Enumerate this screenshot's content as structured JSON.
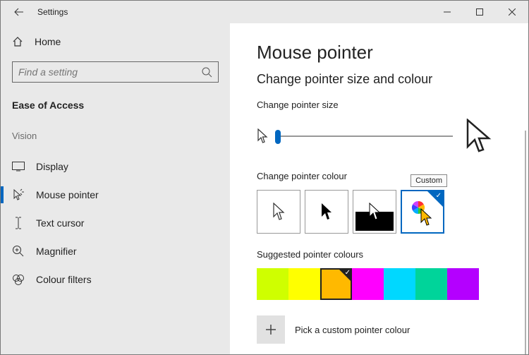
{
  "window": {
    "title": "Settings"
  },
  "sidebar": {
    "home": "Home",
    "search_placeholder": "Find a setting",
    "category": "Ease of Access",
    "group_label": "Vision",
    "items": [
      {
        "label": "Display"
      },
      {
        "label": "Mouse pointer"
      },
      {
        "label": "Text cursor"
      },
      {
        "label": "Magnifier"
      },
      {
        "label": "Colour filters"
      }
    ]
  },
  "main": {
    "heading": "Mouse pointer",
    "subheading": "Change pointer size and colour",
    "size_label": "Change pointer size",
    "colour_label": "Change pointer colour",
    "colour_options": [
      {
        "name": "White"
      },
      {
        "name": "Black"
      },
      {
        "name": "Inverted"
      },
      {
        "name": "Custom",
        "selected": true,
        "tooltip": "Custom"
      }
    ],
    "suggested_label": "Suggested pointer colours",
    "suggested_colours": [
      {
        "hex": "#cfff00"
      },
      {
        "hex": "#ffff00"
      },
      {
        "hex": "#ffb900",
        "selected": true
      },
      {
        "hex": "#ff00ff"
      },
      {
        "hex": "#00d8ff"
      },
      {
        "hex": "#00d49a"
      },
      {
        "hex": "#b400ff"
      }
    ],
    "custom_label": "Pick a custom pointer colour"
  }
}
